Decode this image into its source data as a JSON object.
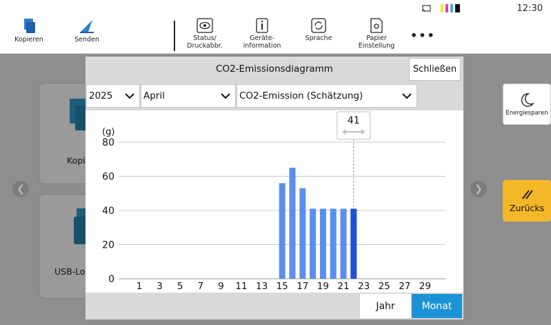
{
  "status": {
    "time": "12:30"
  },
  "toolbar": {
    "items": [
      {
        "label": "Kopieren",
        "icon": "copy-icon"
      },
      {
        "label": "Senden",
        "icon": "send-icon"
      },
      {
        "label": "Status/\nDruckabbr.",
        "icon": "eye-icon"
      },
      {
        "label": "Geräte-\ninformation",
        "icon": "info-icon"
      },
      {
        "label": "Sprache",
        "icon": "language-icon"
      },
      {
        "label": "Papier\nEinstellung",
        "icon": "paper-settings-icon"
      }
    ],
    "more": "•••"
  },
  "background": {
    "tile1_label": "Kopi",
    "tile2_label": "USB-Lo",
    "energy_label": "Energiesparen",
    "back_label": "Zurücks"
  },
  "dialog": {
    "title": "CO2-Emissionsdiagramm",
    "close_label": "Schließen",
    "year_select": "2025",
    "month_select": "April",
    "type_select": "CO2-Emission (Schätzung)",
    "tab_year": "Jahr",
    "tab_month": "Monat"
  },
  "chart_data": {
    "type": "bar",
    "ylabel": "(g)",
    "ylim": [
      0,
      80
    ],
    "yticks": [
      0,
      20,
      40,
      60,
      80
    ],
    "xticks": [
      1,
      3,
      5,
      7,
      9,
      11,
      13,
      15,
      17,
      19,
      21,
      23,
      25,
      27,
      29
    ],
    "days": 30,
    "bars": [
      {
        "day": 15,
        "value": 56
      },
      {
        "day": 16,
        "value": 65
      },
      {
        "day": 17,
        "value": 53
      },
      {
        "day": 18,
        "value": 41
      },
      {
        "day": 19,
        "value": 41
      },
      {
        "day": 20,
        "value": 41
      },
      {
        "day": 21,
        "value": 41
      },
      {
        "day": 22,
        "value": 41
      }
    ],
    "selected_day": 22,
    "cursor_value": "41",
    "colors": {
      "bar": "#5b8ef0",
      "selected": "#1f4fd6",
      "grid": "#c8c8c8"
    }
  }
}
